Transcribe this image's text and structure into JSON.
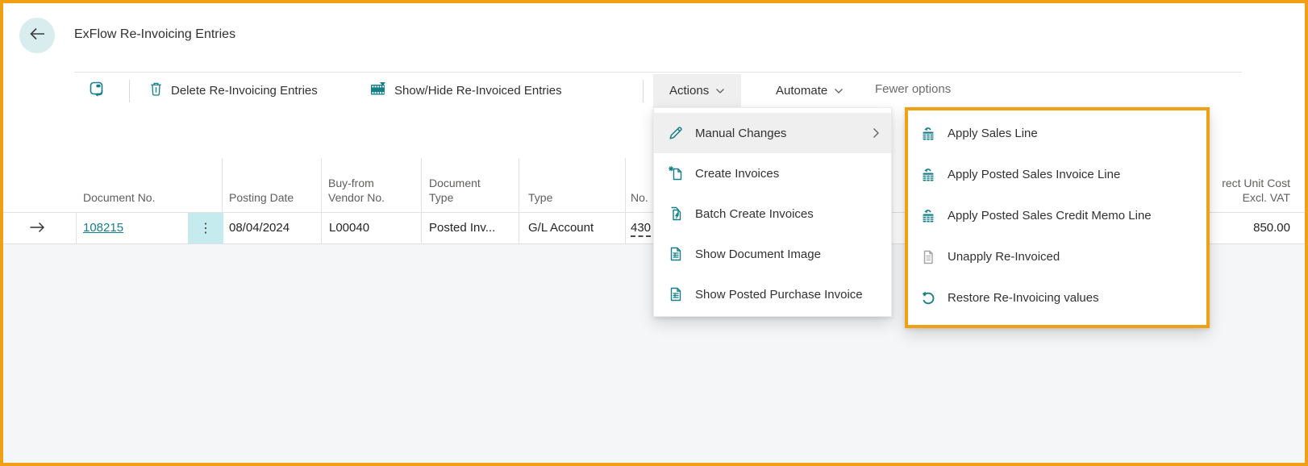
{
  "header": {
    "title": "ExFlow Re-Invoicing Entries"
  },
  "toolbar": {
    "delete_button": "Delete Re-Invoicing Entries",
    "show_hide_button": "Show/Hide Re-Invoiced Entries",
    "actions_menu_label": "Actions",
    "automate_menu_label": "Automate",
    "fewer_options_label": "Fewer options"
  },
  "table": {
    "columns": {
      "document_no": "Document No.",
      "posting_date": "Posting Date",
      "buy_from_line1": "Buy-from",
      "buy_from_line2": "Vendor No.",
      "document_type_line1": "Document",
      "document_type_line2": "Type",
      "type": "Type",
      "no": "No.",
      "unit_cost_line1": "rect Unit Cost",
      "unit_cost_line2": "Excl. VAT"
    },
    "row": {
      "document_no": "108215",
      "posting_date": "08/04/2024",
      "buy_from_vendor_no": "L00040",
      "document_type": "Posted Inv...",
      "type": "G/L Account",
      "no": "430",
      "direct_unit_cost_excl_vat": "850.00",
      "more_options_glyph": "⋮"
    }
  },
  "actions_menu": {
    "items": [
      {
        "label": "Manual Changes",
        "icon": "pencil-icon",
        "has_submenu": true
      },
      {
        "label": "Create Invoices",
        "icon": "create-document-icon"
      },
      {
        "label": "Batch Create Invoices",
        "icon": "batch-document-lightning-icon"
      },
      {
        "label": "Show Document Image",
        "icon": "document-grid-icon"
      },
      {
        "label": "Show Posted Purchase Invoice",
        "icon": "document-grid-icon"
      }
    ]
  },
  "manual_changes_submenu": {
    "items": [
      {
        "label": "Apply Sales Line",
        "icon": "apply-grid-arrow-icon"
      },
      {
        "label": "Apply Posted Sales Invoice Line",
        "icon": "apply-grid-arrow-icon"
      },
      {
        "label": "Apply Posted Sales Credit Memo Line",
        "icon": "apply-grid-arrow-icon"
      },
      {
        "label": "Unapply Re-Invoiced",
        "icon": "document-gray-icon"
      },
      {
        "label": "Restore Re-Invoicing values",
        "icon": "undo-arrow-icon"
      }
    ]
  },
  "colors": {
    "accent_teal": "#177E87",
    "highlight_orange": "#EFA015",
    "menu_highlight_gray": "#EFEFEF",
    "row_dots_background": "#C6EBEF",
    "background_below_rows": "#F5F6F7"
  }
}
